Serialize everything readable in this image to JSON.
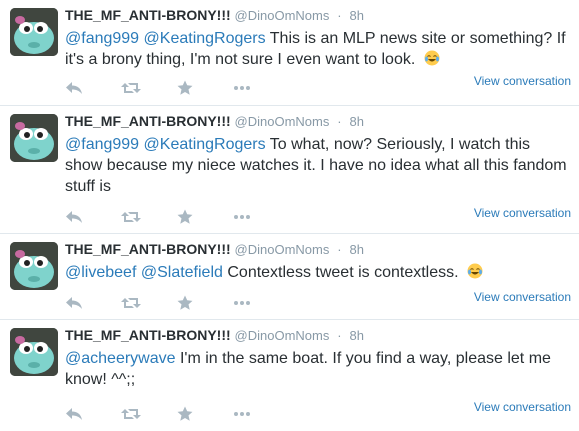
{
  "tweets": [
    {
      "fullname": "THE_MF_ANTI-BRONY!!!",
      "username": "@DinoOmNoms",
      "dot": "·",
      "time": "8h",
      "mentions": [
        "@fang999",
        "@KeatingRogers"
      ],
      "text": "This is an MLP news site or something? If it's a brony thing, I'm not sure I even want to look.",
      "emoji": "tears-of-joy-emoji",
      "view_conversation": "View conversation"
    },
    {
      "fullname": "THE_MF_ANTI-BRONY!!!",
      "username": "@DinoOmNoms",
      "dot": "·",
      "time": "8h",
      "mentions": [
        "@fang999",
        "@KeatingRogers"
      ],
      "text": "To what, now? Seriously, I watch this show because my niece watches it. I have no idea what all this fandom stuff is",
      "view_conversation": "View conversation"
    },
    {
      "fullname": "THE_MF_ANTI-BRONY!!!",
      "username": "@DinoOmNoms",
      "dot": "·",
      "time": "8h",
      "mentions": [
        "@livebeef",
        "@Slatefield"
      ],
      "text": "Contextless tweet is contextless.",
      "emoji": "tears-of-joy-emoji",
      "view_conversation": "View conversation"
    },
    {
      "fullname": "THE_MF_ANTI-BRONY!!!",
      "username": "@DinoOmNoms",
      "dot": "·",
      "time": "8h",
      "mentions": [
        "@acheerywave"
      ],
      "text": "I'm in the same boat. If you find a way, please let me know! ^^;;",
      "view_conversation": "View conversation"
    }
  ],
  "colors": {
    "link": "#2b7bb9",
    "muted": "#8899a6",
    "icon": "#aab8c2",
    "divider": "#e1e8ed"
  },
  "icons": [
    "reply-icon",
    "retweet-icon",
    "favorite-icon",
    "more-icon"
  ]
}
